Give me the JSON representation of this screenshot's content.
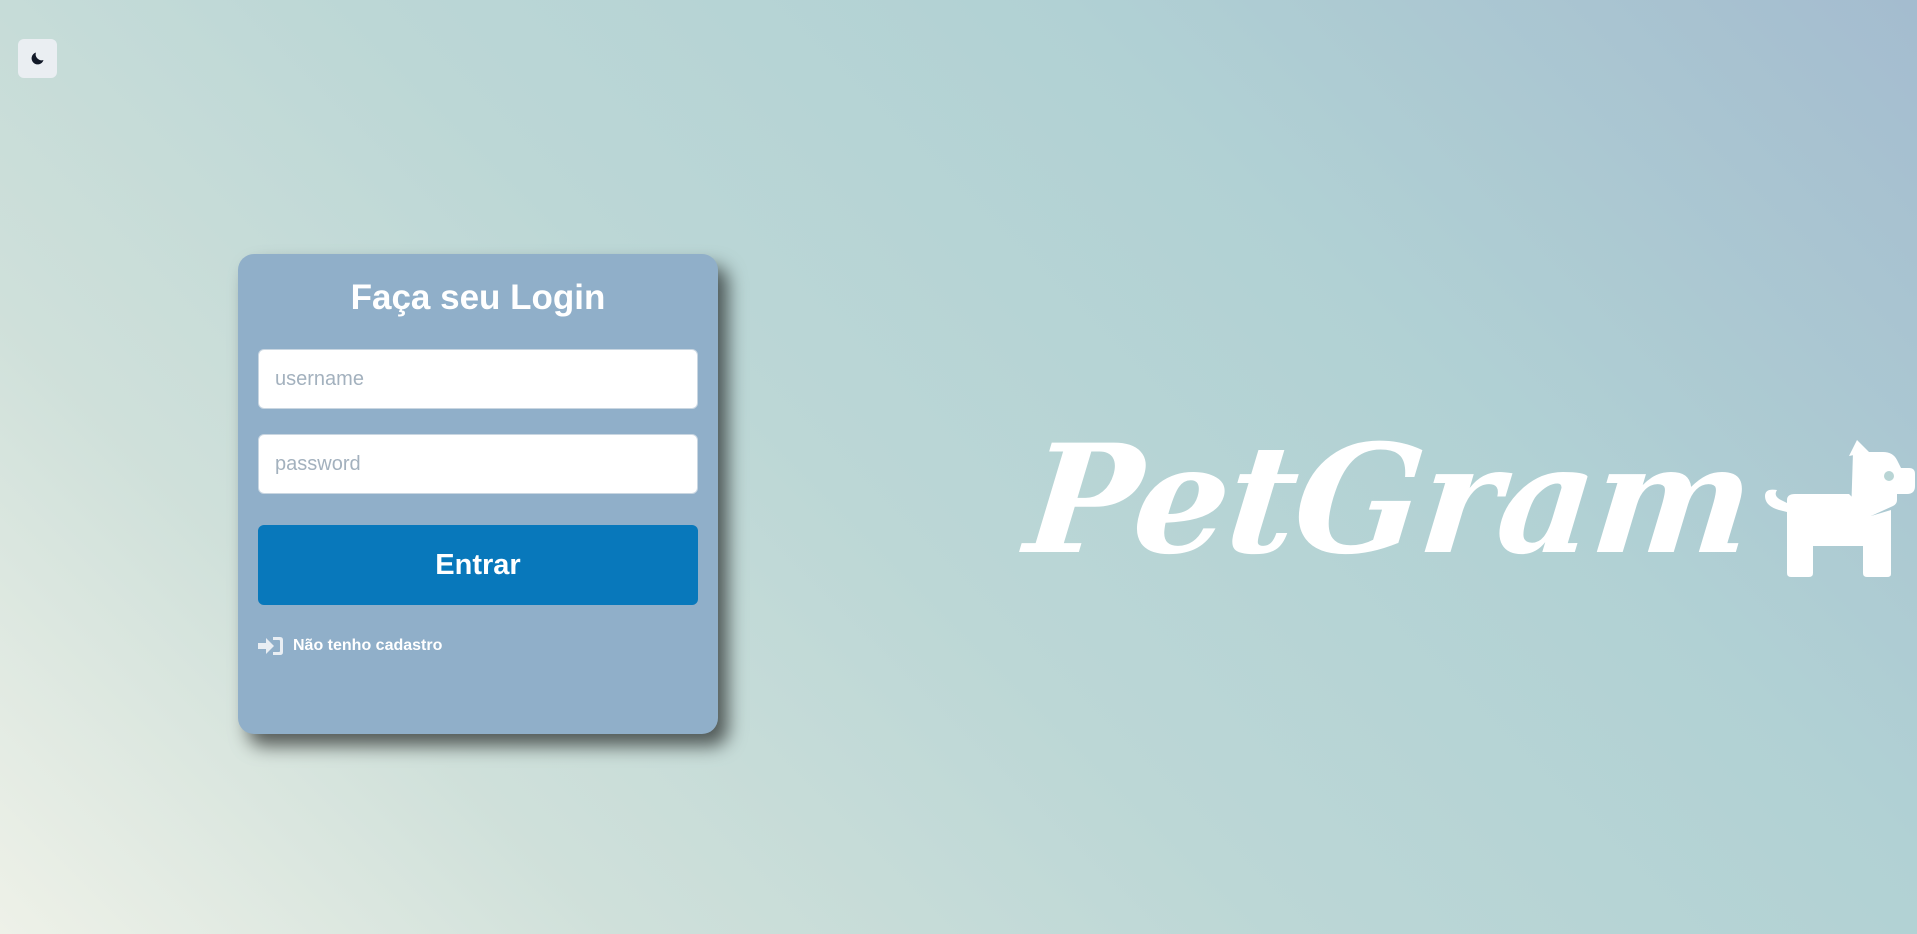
{
  "theme_toggle": {
    "icon": "moon-icon"
  },
  "login": {
    "title": "Faça seu Login",
    "username_placeholder": "username",
    "username_value": "",
    "password_placeholder": "password",
    "password_value": "",
    "submit_label": "Entrar",
    "register_label": "Não tenho cadastro",
    "register_icon": "sign-in-icon"
  },
  "brand": {
    "name": "PetGram",
    "icon": "dog-icon"
  },
  "colors": {
    "card_background": "#90afc9",
    "primary_button": "#0878bb",
    "text_on_card": "#ffffff"
  }
}
